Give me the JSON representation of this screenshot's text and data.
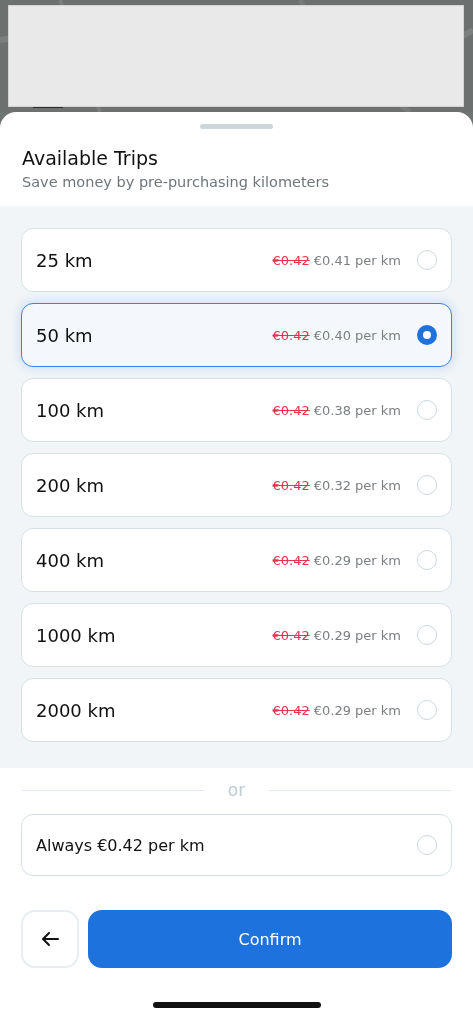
{
  "sheet": {
    "title": "Available Trips",
    "subtitle": "Save money by pre-purchasing kilometers"
  },
  "bundles": [
    {
      "distance": "25 km",
      "old_price": "€0.42",
      "price": "€0.41 per km",
      "selected": false
    },
    {
      "distance": "50 km",
      "old_price": "€0.42",
      "price": "€0.40 per km",
      "selected": true
    },
    {
      "distance": "100 km",
      "old_price": "€0.42",
      "price": "€0.38 per km",
      "selected": false
    },
    {
      "distance": "200 km",
      "old_price": "€0.42",
      "price": "€0.32 per km",
      "selected": false
    },
    {
      "distance": "400 km",
      "old_price": "€0.42",
      "price": "€0.29 per km",
      "selected": false
    },
    {
      "distance": "1000 km",
      "old_price": "€0.42",
      "price": "€0.29 per km",
      "selected": false
    },
    {
      "distance": "2000 km",
      "old_price": "€0.42",
      "price": "€0.29 per km",
      "selected": false
    }
  ],
  "separator": "or",
  "payg": {
    "label": "Always €0.42 per km",
    "selected": false
  },
  "confirm_button": "Confirm"
}
